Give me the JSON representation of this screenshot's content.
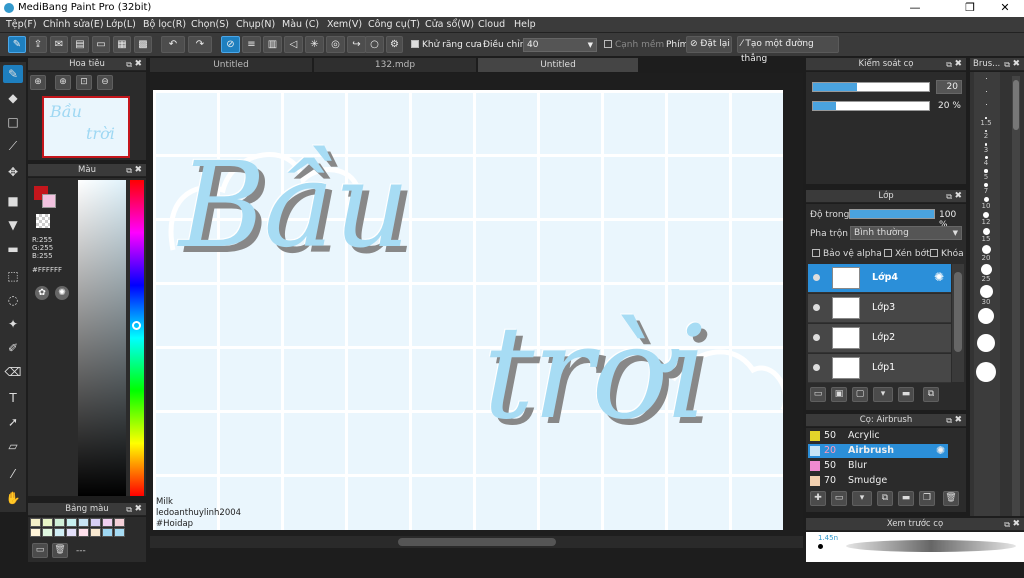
{
  "window": {
    "title": "MediBang Paint Pro (32bit)",
    "min": "—",
    "max": "❐",
    "close": "✕"
  },
  "menu": [
    "Tệp(F)",
    "Chỉnh sửa(E)",
    "Lớp(L)",
    "Bộ lọc(R)",
    "Chọn(S)",
    "Chụp(N)",
    "Màu (C)",
    "Xem(V)",
    "Công cụ(T)",
    "Cửa sổ(W)",
    "Cloud",
    "Help"
  ],
  "toolbar": {
    "antialias_label": "Khử răng cưa",
    "correction_label": "Điều chỉnh",
    "correction_value": "40",
    "edge_label": "Cạnh mềm",
    "key_label": "Phím",
    "reset_label": "Đặt lại",
    "straight_label": "Tạo một đường thẳng"
  },
  "tabs": [
    "Untitled",
    "132.mdp",
    "Untitled"
  ],
  "navigator": {
    "title": "Hoa tiêu"
  },
  "color": {
    "title": "Màu",
    "r": "R:255",
    "g": "G:255",
    "b": "B:255",
    "hex": "#FFFFFF",
    "fg_color": "#c4161c",
    "bg_color": "#ffffff"
  },
  "palette": {
    "title": "Bảng màu",
    "more": "---"
  },
  "canvas": {
    "line1": "Bầu",
    "line2": "trời",
    "credit": [
      "Milk",
      "ledoanthuylinh2004",
      "#Hoidap"
    ]
  },
  "brushctrl": {
    "title": "Kiểm soát cọ",
    "size": "20",
    "opacity": "20 %",
    "size_fill": 0.38,
    "opacity_fill": 0.2
  },
  "layer": {
    "title": "Lớp",
    "opacity_label": "Độ trong",
    "opacity_value": "100 %",
    "blend_label": "Pha trộn",
    "blend_value": "Bình thường",
    "protect_alpha": "Bảo vệ alpha",
    "clip": "Xén bớt",
    "lock": "Khóa",
    "layers": [
      "Lớp4",
      "Lớp3",
      "Lớp2",
      "Lớp1"
    ]
  },
  "brushes": {
    "title": "Cọ: Airbrush",
    "items": [
      {
        "size": "50",
        "name": "Acrylic",
        "color": "#e3d42a"
      },
      {
        "size": "20",
        "name": "Airbrush",
        "color": "#c9e5f5"
      },
      {
        "size": "50",
        "name": "Blur",
        "color": "#f08ad0"
      },
      {
        "size": "70",
        "name": "Smudge",
        "color": "#f2d0b0"
      }
    ]
  },
  "brushsizes": {
    "title": "Brus...",
    "labels": [
      "1.5",
      "2",
      "3",
      "4",
      "5",
      "7",
      "10",
      "12",
      "15",
      "20",
      "25",
      "30"
    ]
  },
  "preview": {
    "title": "Xem trước cọ",
    "size": "1.45n"
  }
}
